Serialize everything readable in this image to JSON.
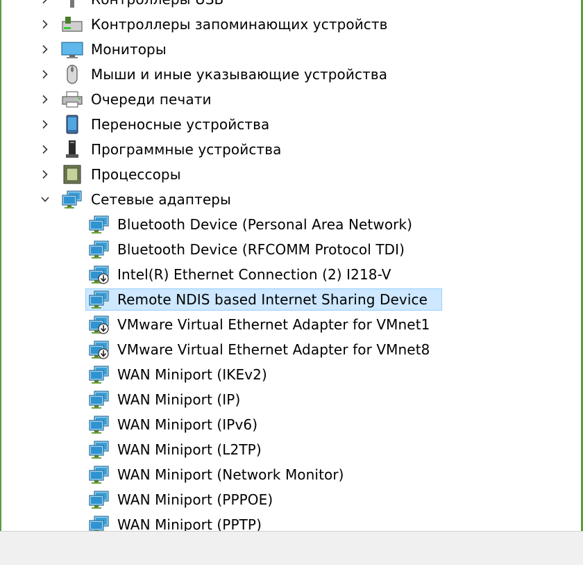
{
  "window": {
    "accent_color": "#5c9a40",
    "selection_color": "#cde8ff"
  },
  "tree": {
    "categories": [
      {
        "label": "Контроллеры USB",
        "icon": "usb-controller-icon",
        "expanded": false
      },
      {
        "label": "Контроллеры запоминающих устройств",
        "icon": "storage-controller-icon",
        "expanded": false
      },
      {
        "label": "Мониторы",
        "icon": "monitor-icon",
        "expanded": false
      },
      {
        "label": "Мыши и иные указывающие устройства",
        "icon": "mouse-icon",
        "expanded": false
      },
      {
        "label": "Очереди печати",
        "icon": "printer-icon",
        "expanded": false
      },
      {
        "label": "Переносные устройства",
        "icon": "portable-device-icon",
        "expanded": false
      },
      {
        "label": "Программные устройства",
        "icon": "software-device-icon",
        "expanded": false
      },
      {
        "label": "Процессоры",
        "icon": "processor-icon",
        "expanded": false
      },
      {
        "label": "Сетевые адаптеры",
        "icon": "network-adapter-icon",
        "expanded": true
      }
    ],
    "network_adapters": [
      {
        "label": "Bluetooth Device (Personal Area Network)",
        "icon": "network-adapter-icon",
        "disabled": false,
        "selected": false
      },
      {
        "label": "Bluetooth Device (RFCOMM Protocol TDI)",
        "icon": "network-adapter-icon",
        "disabled": false,
        "selected": false
      },
      {
        "label": "Intel(R) Ethernet Connection (2) I218-V",
        "icon": "network-adapter-disabled-icon",
        "disabled": true,
        "selected": false
      },
      {
        "label": "Remote NDIS based Internet Sharing Device",
        "icon": "network-adapter-icon",
        "disabled": false,
        "selected": true
      },
      {
        "label": "VMware Virtual Ethernet Adapter for VMnet1",
        "icon": "network-adapter-disabled-icon",
        "disabled": true,
        "selected": false
      },
      {
        "label": "VMware Virtual Ethernet Adapter for VMnet8",
        "icon": "network-adapter-disabled-icon",
        "disabled": true,
        "selected": false
      },
      {
        "label": "WAN Miniport (IKEv2)",
        "icon": "network-adapter-icon",
        "disabled": false,
        "selected": false
      },
      {
        "label": "WAN Miniport (IP)",
        "icon": "network-adapter-icon",
        "disabled": false,
        "selected": false
      },
      {
        "label": "WAN Miniport (IPv6)",
        "icon": "network-adapter-icon",
        "disabled": false,
        "selected": false
      },
      {
        "label": "WAN Miniport (L2TP)",
        "icon": "network-adapter-icon",
        "disabled": false,
        "selected": false
      },
      {
        "label": "WAN Miniport (Network Monitor)",
        "icon": "network-adapter-icon",
        "disabled": false,
        "selected": false
      },
      {
        "label": "WAN Miniport (PPPOE)",
        "icon": "network-adapter-icon",
        "disabled": false,
        "selected": false
      },
      {
        "label": "WAN Miniport (PPTP)",
        "icon": "network-adapter-icon",
        "disabled": false,
        "selected": false
      }
    ]
  }
}
